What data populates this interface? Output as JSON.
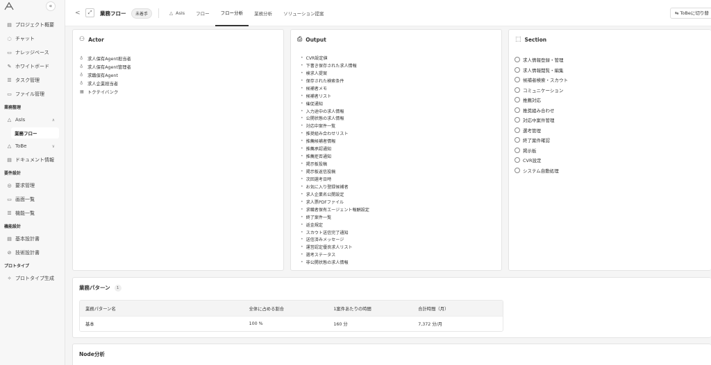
{
  "sidebar": {
    "collapse_glyph": "«",
    "items": [
      {
        "type": "item",
        "label": "プロジェクト概要",
        "icon": "document-icon",
        "glyph": "▤"
      },
      {
        "type": "item",
        "label": "チャット",
        "icon": "chat-icon",
        "glyph": "◌"
      },
      {
        "type": "item",
        "label": "ナレッジベース",
        "icon": "knowledge-icon",
        "glyph": "▭"
      },
      {
        "type": "item",
        "label": "ホワイトボード",
        "icon": "pen-icon",
        "glyph": "✎"
      },
      {
        "type": "item",
        "label": "タスク管理",
        "icon": "list-icon",
        "glyph": "☰"
      },
      {
        "type": "item",
        "label": "ファイル管理",
        "icon": "folder-icon",
        "glyph": "▭"
      },
      {
        "type": "section",
        "label": "業務整理"
      },
      {
        "type": "item",
        "label": "AsIs",
        "icon": "asis-icon",
        "glyph": "△",
        "chevron": "∧"
      },
      {
        "type": "sub",
        "label": "業務フロー"
      },
      {
        "type": "item",
        "label": "ToBe",
        "icon": "tobe-icon",
        "glyph": "△",
        "chevron": "∨"
      },
      {
        "type": "item",
        "label": "ドキュメント情報",
        "icon": "document-icon",
        "glyph": "▤"
      },
      {
        "type": "section",
        "label": "要件設計"
      },
      {
        "type": "item",
        "label": "要求管理",
        "icon": "target-icon",
        "glyph": "◎"
      },
      {
        "type": "item",
        "label": "画面一覧",
        "icon": "monitor-icon",
        "glyph": "▭"
      },
      {
        "type": "item",
        "label": "機能一覧",
        "icon": "list-icon",
        "glyph": "☰"
      },
      {
        "type": "section",
        "label": "機能設計"
      },
      {
        "type": "item",
        "label": "基本設計書",
        "icon": "document-icon",
        "glyph": "▤"
      },
      {
        "type": "item",
        "label": "技術設計書",
        "icon": "compass-icon",
        "glyph": "⊘"
      },
      {
        "type": "section",
        "label": "プロトタイプ"
      },
      {
        "type": "item",
        "label": "プロトタイプ生成",
        "icon": "sparkle-icon",
        "glyph": "✧"
      }
    ]
  },
  "topbar": {
    "back_glyph": "<",
    "flow_glyph": "⤢",
    "title": "業務フロー",
    "badge": "未着手",
    "tabs": [
      {
        "label": "AsIs",
        "icon": "△",
        "active": false
      },
      {
        "label": "フロー",
        "active": false
      },
      {
        "label": "フロー分析",
        "active": true
      },
      {
        "label": "業務分析",
        "active": false
      },
      {
        "label": "ソリューション提案",
        "active": false
      }
    ],
    "tobe_button": "⇆ ToBeに切り替",
    "tobe_glyph": ""
  },
  "actor": {
    "title": "Actor",
    "icon_glyph": "⚇",
    "items": [
      {
        "label": "求人保有Agent担当者",
        "glyph": "♁"
      },
      {
        "label": "求人保有Agent管理者",
        "glyph": "♁"
      },
      {
        "label": "求職保有Agent",
        "glyph": "♁"
      },
      {
        "label": "求人企業担当者",
        "glyph": "♁"
      },
      {
        "label": "トクテイバンク",
        "glyph": "▦"
      }
    ]
  },
  "output": {
    "title": "Output",
    "icon_glyph": "⎙",
    "items": [
      "CVR設定値",
      "下書き保存された求人情報",
      "検求人提案",
      "保存された検索条件",
      "候補者メモ",
      "候補者リスト",
      "催促通知",
      "入力途中の求人情報",
      "公開状態の求人情報",
      "対応中案件一覧",
      "推奨組み合わせリスト",
      "推薦候補者情報",
      "推薦承認通知",
      "推薦拒否通知",
      "掲示板投稿",
      "掲示板返信投稿",
      "次回選考日時",
      "お気に入り登録候補者",
      "求人企業名公開設定",
      "求人票PDFファイル",
      "求職者保有エージェント報酬設定",
      "終了案件一覧",
      "返金規定",
      "スカウト送信完了通知",
      "送信済みメッセージ",
      "運営認定優良求人リスト",
      "選考ステータス",
      "非公開状態の求人情報"
    ]
  },
  "section": {
    "title": "Section",
    "icon_glyph": "⬚",
    "items": [
      "求人情報登録・管理",
      "求人情報閲覧・編集",
      "候補者検索・スカウト",
      "コミュニケーション",
      "推薦対応",
      "推奨組み合わせ",
      "対応中案件管理",
      "選考管理",
      "終了案件確認",
      "掲示板",
      "CVR設定",
      "システム自動処理"
    ]
  },
  "pattern": {
    "title": "業務パターン",
    "count": "1",
    "headers": [
      "業務パターン名",
      "全体に占める割合",
      "1案件あたりの時間",
      "合計時間（月）"
    ],
    "rows": [
      [
        "基本",
        "100 %",
        "160 分",
        "7,372 分/月"
      ]
    ]
  },
  "node": {
    "title": "Node分析"
  }
}
